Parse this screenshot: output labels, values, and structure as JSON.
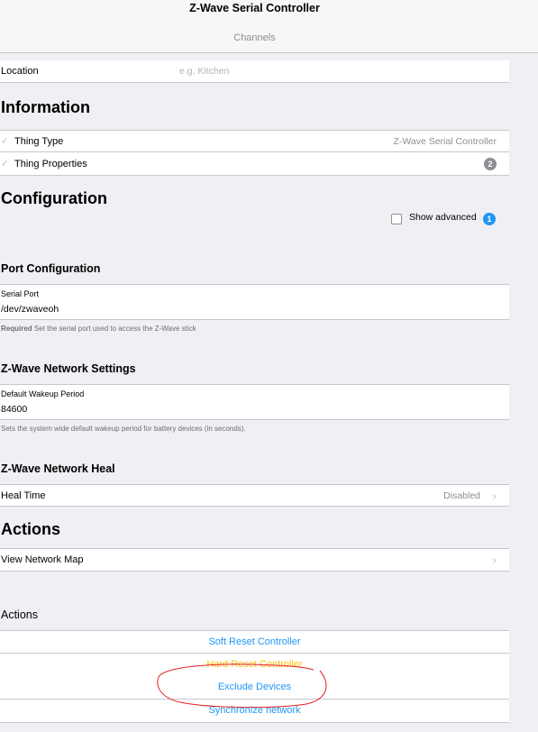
{
  "header": {
    "title": "Z-Wave Serial Controller",
    "subtitle": "Channels"
  },
  "location": {
    "label": "Location",
    "placeholder": "e.g. Kitchen"
  },
  "information": {
    "title": "Information",
    "thing_type_label": "Thing Type",
    "thing_type_value": "Z-Wave Serial Controller",
    "thing_properties_label": "Thing Properties",
    "thing_properties_count": "2"
  },
  "configuration": {
    "title": "Configuration",
    "show_advanced_label": "Show advanced",
    "show_advanced_count": "1",
    "port_section": "Port Configuration",
    "serial_port_label": "Serial Port",
    "serial_port_value": "/dev/zwaveoh",
    "serial_port_hint_required": "Required",
    "serial_port_hint": " Set the serial port used to access the Z-Wave stick",
    "network_section": "Z-Wave Network Settings",
    "wakeup_label": "Default Wakeup Period",
    "wakeup_value": "84600",
    "wakeup_hint": "Sets the system wide default wakeup period for battery devices (in seconds).",
    "heal_section": "Z-Wave Network Heal",
    "heal_time_label": "Heal Time",
    "heal_time_value": "Disabled"
  },
  "actions": {
    "title": "Actions",
    "view_network_map": "View Network Map",
    "subsection": "Actions",
    "buttons": [
      "Soft Reset Controller",
      "Hard Reset Controller",
      "Exclude Devices",
      "Synchronize network"
    ]
  },
  "colors": {
    "accent": "#2196f3",
    "warning": "#ffc107",
    "annotation": "#e02020"
  }
}
